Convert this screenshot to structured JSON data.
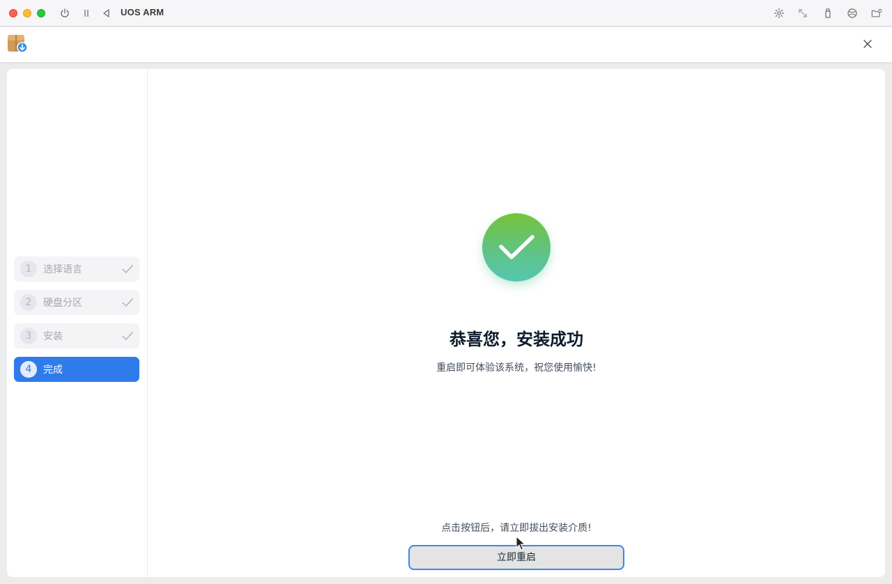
{
  "vm": {
    "title": "UOS ARM",
    "left_icons": [
      "power-icon",
      "pause-icon",
      "back-icon"
    ],
    "right_icons": [
      "brightness-icon",
      "resize-icon",
      "usb-icon",
      "network-icon",
      "shared-folder-icon"
    ]
  },
  "app": {
    "logo": "installer-package-icon",
    "close": "close-icon"
  },
  "sidebar": {
    "steps": [
      {
        "number": "1",
        "label": "选择语言",
        "status": "done"
      },
      {
        "number": "2",
        "label": "硬盘分区",
        "status": "done"
      },
      {
        "number": "3",
        "label": "安装",
        "status": "done"
      },
      {
        "number": "4",
        "label": "完成",
        "status": "active"
      }
    ]
  },
  "main": {
    "title": "恭喜您，安装成功",
    "subtitle": "重启即可体验该系统，祝您使用愉快!",
    "warning": "点击按钮后，请立即拔出安装介质!",
    "restart_button": "立即重启"
  },
  "colors": {
    "accent": "#2f7bea",
    "success_top": "#74c33a",
    "success_bottom": "#55c6b2"
  }
}
